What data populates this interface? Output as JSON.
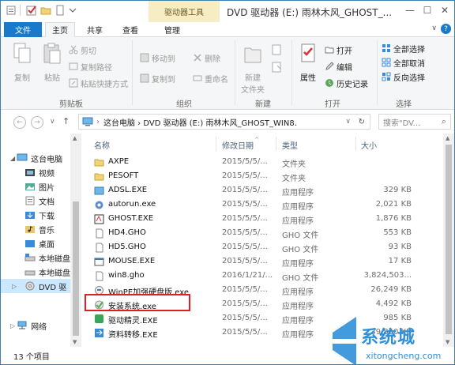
{
  "title_bar": {
    "context_tab": "驱动器工具",
    "title": "DVD 驱动器 (E:) 雨林木风_GHOST_...",
    "minimize": "—",
    "maximize": "☐",
    "close": "✕"
  },
  "tabs": {
    "file": "文件",
    "home": "主页",
    "share": "共享",
    "view": "查看",
    "manage": "管理",
    "help": "?"
  },
  "ribbon": {
    "copy": "复制",
    "paste": "粘贴",
    "cut": "剪切",
    "copy_path": "复制路径",
    "paste_shortcut": "粘贴快捷方式",
    "clipboard": "剪贴板",
    "move_to": "移动到",
    "copy_to": "复制到",
    "delete": "删除",
    "rename": "重命名",
    "organize": "组织",
    "new_folder_1": "新建",
    "new_folder_2": "文件夹",
    "new": "新建",
    "properties": "属性",
    "open_label": "打开",
    "edit": "编辑",
    "history": "历史记录",
    "open": "打开",
    "select_all": "全部选择",
    "select_none": "全部取消",
    "invert": "反向选择",
    "select": "选择"
  },
  "address": {
    "path": "这台电脑  ›  DVD 驱动器 (E:) 雨林木风_GHOST_WIN8.",
    "search_placeholder": "搜索\"DV..."
  },
  "nav": {
    "items": [
      {
        "label": "这台电脑"
      },
      {
        "label": "视频"
      },
      {
        "label": "图片"
      },
      {
        "label": "文档"
      },
      {
        "label": "下载"
      },
      {
        "label": "音乐"
      },
      {
        "label": "桌面"
      },
      {
        "label": "本地磁盘"
      },
      {
        "label": "本地磁盘"
      },
      {
        "label": "DVD 驱"
      },
      {
        "label": "网络"
      }
    ]
  },
  "columns": {
    "name": "名称",
    "date": "修改日期",
    "type": "类型",
    "size": "大小"
  },
  "files": [
    {
      "name": "AXPE",
      "date": "2015/5/5/...",
      "type": "文件夹",
      "size": "",
      "icon": "folder-icon"
    },
    {
      "name": "PESOFT",
      "date": "2015/5/5/...",
      "type": "文件夹",
      "size": "",
      "icon": "folder-icon"
    },
    {
      "name": "ADSL.EXE",
      "date": "2015/5/5/...",
      "type": "应用程序",
      "size": "329 KB",
      "icon": "network-app-icon"
    },
    {
      "name": "autorun.exe",
      "date": "2015/5/5/...",
      "type": "应用程序",
      "size": "2,021 KB",
      "icon": "gear-app-icon"
    },
    {
      "name": "GHOST.EXE",
      "date": "2015/5/5/...",
      "type": "应用程序",
      "size": "1,876 KB",
      "icon": "ghost-app-icon"
    },
    {
      "name": "HD4.GHO",
      "date": "2015/5/5/...",
      "type": "GHO 文件",
      "size": "553 KB",
      "icon": "file-icon"
    },
    {
      "name": "HD5.GHO",
      "date": "2015/5/5/...",
      "type": "GHO 文件",
      "size": "93 KB",
      "icon": "file-icon"
    },
    {
      "name": "MOUSE.EXE",
      "date": "2015/5/5/...",
      "type": "应用程序",
      "size": "17 KB",
      "icon": "window-app-icon"
    },
    {
      "name": "win8.gho",
      "date": "2016/1/21/...",
      "type": "GHO 文件",
      "size": "3,824,503...",
      "icon": "file-icon"
    },
    {
      "name": "WinPE加强硬盘版.exe",
      "date": "2015/5/5/...",
      "type": "应用程序",
      "size": "26,249 KB",
      "icon": "winpe-app-icon"
    },
    {
      "name": "安装系统.exe",
      "date": "2015/5/5/...",
      "type": "应用程序",
      "size": "4,492 KB",
      "icon": "installer-icon"
    },
    {
      "name": "驱动精灵.EXE",
      "date": "2015/5/5/...",
      "type": "应用程序",
      "size": "985 KB",
      "icon": "driver-app-icon"
    },
    {
      "name": "资料转移.EXE",
      "date": "2015/5/5/...",
      "type": "应用程序",
      "size": "39,850 KB",
      "icon": "transfer-app-icon"
    }
  ],
  "status": {
    "count": "13 个项目"
  },
  "watermark": {
    "text": "系统城",
    "url": "xitongcheng.com"
  },
  "colors": {
    "accent": "#1979ca",
    "context_tab": "#f7edc4",
    "selection": "#cce8ff",
    "highlight_box": "#e02020",
    "watermark": "#2f8fd8"
  }
}
